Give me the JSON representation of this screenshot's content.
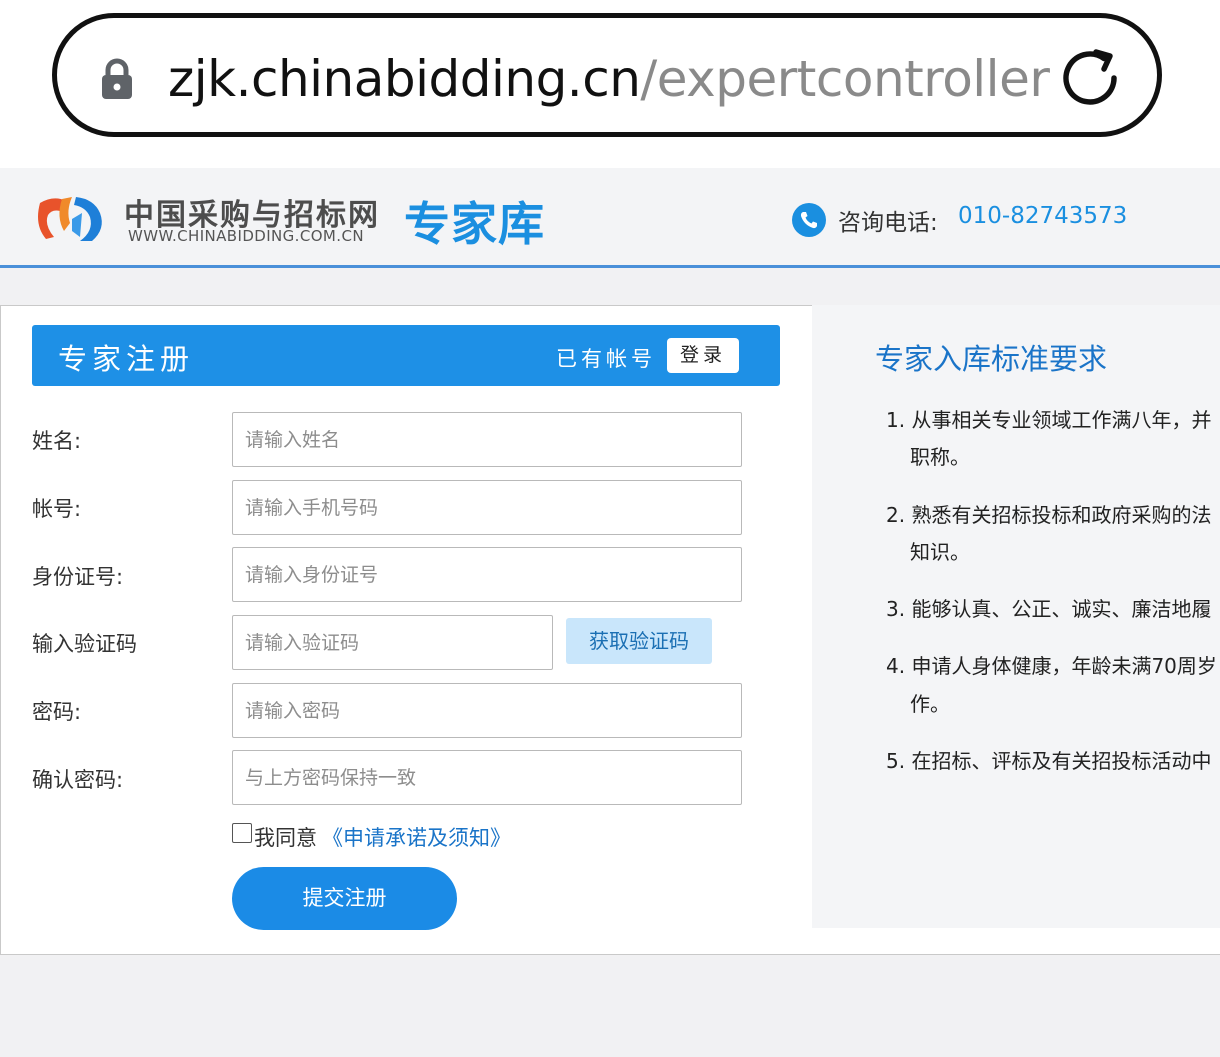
{
  "browser": {
    "url_domain": "zjk.chinabidding.cn",
    "url_path": "/expertcontroller"
  },
  "header": {
    "logo_cn": "中国采购与招标网",
    "logo_en": "WWW.CHINABIDDING.COM.CN",
    "logo_section": "专家库",
    "phone_label": "咨询电话:",
    "phone_number": "010-82743573"
  },
  "registration": {
    "title": "专家注册",
    "have_account": "已有帐号",
    "login_label": "登录",
    "fields": [
      {
        "label": "姓名:",
        "placeholder": "请输入姓名"
      },
      {
        "label": "帐号:",
        "placeholder": "请输入手机号码"
      },
      {
        "label": "身份证号:",
        "placeholder": "请输入身份证号"
      },
      {
        "label": "输入验证码",
        "placeholder": "请输入验证码"
      },
      {
        "label": "密码:",
        "placeholder": "请输入密码"
      },
      {
        "label": "确认密码:",
        "placeholder": "与上方密码保持一致"
      }
    ],
    "get_code_label": "获取验证码",
    "agree_text": "我同意",
    "agree_link": "《申请承诺及须知》",
    "agree_checked": false,
    "submit_label": "提交注册"
  },
  "requirements": {
    "title": "专家入库标准要求",
    "items": [
      {
        "line1": "1. 从事相关专业领域工作满八年，并",
        "line2": "职称。"
      },
      {
        "line1": "2. 熟悉有关招标投标和政府采购的法",
        "line2": "知识。"
      },
      {
        "line1": "3. 能够认真、公正、诚实、廉洁地履",
        "line2": ""
      },
      {
        "line1": "4. 申请人身体健康，年龄未满70周岁",
        "line2": "作。"
      },
      {
        "line1": "5. 在招标、评标及有关招投标活动中",
        "line2": ""
      }
    ]
  },
  "colors": {
    "accent": "#1e90e6",
    "link": "#1a74c8",
    "code_button_bg": "#c9e6fb"
  }
}
